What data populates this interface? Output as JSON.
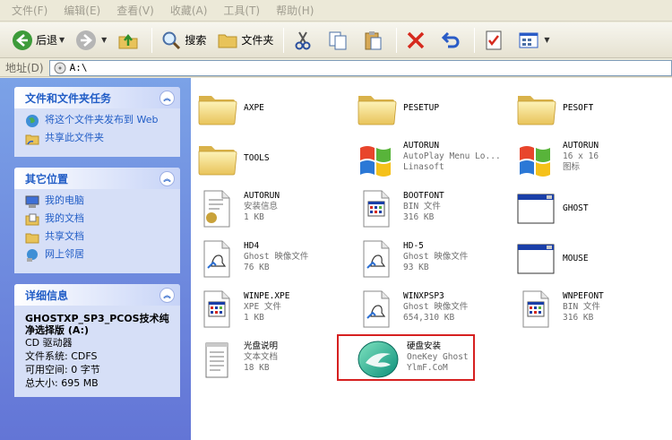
{
  "menu": [
    "文件(F)",
    "编辑(E)",
    "查看(V)",
    "收藏(A)",
    "工具(T)",
    "帮助(H)"
  ],
  "toolbar": {
    "back": "后退",
    "search": "搜索",
    "folders": "文件夹"
  },
  "address": {
    "label": "地址(D)",
    "value": "A:\\"
  },
  "tasks_panel": {
    "title": "文件和文件夹任务",
    "items": [
      "将这个文件夹发布到 Web",
      "共享此文件夹"
    ]
  },
  "places_panel": {
    "title": "其它位置",
    "items": [
      "我的电脑",
      "我的文档",
      "共享文档",
      "网上邻居"
    ]
  },
  "details_panel": {
    "title": "详细信息",
    "name": "GHOSTXP_SP3_PCOS技术纯净选择版 (A:)",
    "type": "CD 驱动器",
    "fs": "文件系统: CDFS",
    "free": "可用空间: 0 字节",
    "total": "总大小: 695 MB"
  },
  "files": [
    {
      "name": "AXPE",
      "line2": "",
      "line3": "",
      "icon": "folder-icon"
    },
    {
      "name": "PESETUP",
      "line2": "",
      "line3": "",
      "icon": "folder-icon"
    },
    {
      "name": "PESOFT",
      "line2": "",
      "line3": "",
      "icon": "folder-icon"
    },
    {
      "name": "TOOLS",
      "line2": "",
      "line3": "",
      "icon": "folder-icon"
    },
    {
      "name": "AUTORUN",
      "line2": "AutoPlay Menu Lo...",
      "line3": "Linasoft",
      "icon": "windows-logo-icon"
    },
    {
      "name": "AUTORUN",
      "line2": "16 x 16",
      "line3": "图标",
      "icon": "windows-logo-icon"
    },
    {
      "name": "AUTORUN",
      "line2": "安装信息",
      "line3": "1 KB",
      "icon": "setup-info-icon"
    },
    {
      "name": "BOOTFONT",
      "line2": "BIN 文件",
      "line3": "316 KB",
      "icon": "generic-file-icon"
    },
    {
      "name": "GHOST",
      "line2": "",
      "line3": "",
      "icon": "application-window-icon"
    },
    {
      "name": "HD4",
      "line2": "Ghost 映像文件",
      "line3": "76 KB",
      "icon": "ghost-image-icon"
    },
    {
      "name": "HD-5",
      "line2": "Ghost 映像文件",
      "line3": "93 KB",
      "icon": "ghost-image-icon"
    },
    {
      "name": "MOUSE",
      "line2": "",
      "line3": "",
      "icon": "application-window-icon"
    },
    {
      "name": "WINPE.XPE",
      "line2": "XPE 文件",
      "line3": "1 KB",
      "icon": "generic-file-icon"
    },
    {
      "name": "WINXPSP3",
      "line2": "Ghost 映像文件",
      "line3": "654,310 KB",
      "icon": "ghost-image-icon"
    },
    {
      "name": "WNPEFONT",
      "line2": "BIN 文件",
      "line3": "316 KB",
      "icon": "generic-file-icon"
    },
    {
      "name": "光盘说明",
      "line2": "文本文档",
      "line3": "18 KB",
      "icon": "text-document-icon"
    },
    {
      "name": "硬盘安装",
      "line2": "OneKey Ghost",
      "line3": "YlmF.CoM",
      "icon": "onekey-ghost-icon"
    }
  ]
}
